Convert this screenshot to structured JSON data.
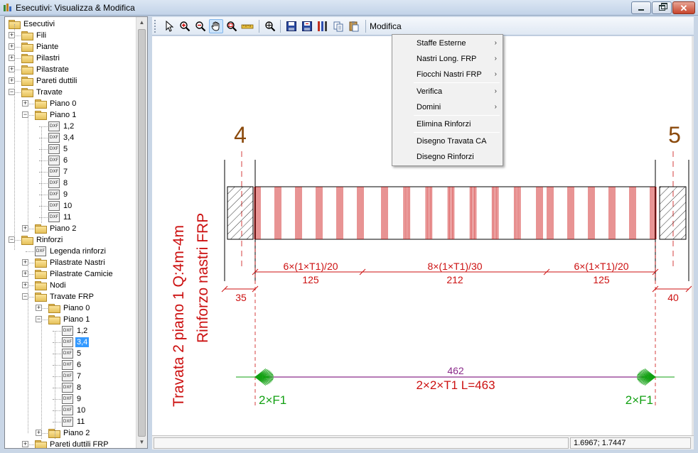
{
  "window": {
    "title": "Esecutivi: Visualizza & Modifica",
    "icon": "app-logo-icon"
  },
  "tree": {
    "items": [
      {
        "label": "Esecutivi",
        "icon": "folder-open-icon",
        "expander": "-"
      },
      {
        "label": "Fili",
        "icon": "folder-icon",
        "expander": "+"
      },
      {
        "label": "Piante",
        "icon": "folder-icon",
        "expander": "+"
      },
      {
        "label": "Pilastri",
        "icon": "folder-icon",
        "expander": "+"
      },
      {
        "label": "Pilastrate",
        "icon": "folder-icon",
        "expander": "+"
      },
      {
        "label": "Pareti duttili",
        "icon": "folder-icon",
        "expander": "+"
      },
      {
        "label": "Travate",
        "icon": "folder-open-icon",
        "expander": "-"
      },
      {
        "label": "Piano 0",
        "icon": "folder-icon",
        "expander": "+"
      },
      {
        "label": "Piano 1",
        "icon": "folder-open-icon",
        "expander": "-"
      },
      {
        "label": "1,2",
        "icon": "dxf-file-icon"
      },
      {
        "label": "3,4",
        "icon": "dxf-file-icon"
      },
      {
        "label": "5",
        "icon": "dxf-file-icon"
      },
      {
        "label": "6",
        "icon": "dxf-file-icon"
      },
      {
        "label": "7",
        "icon": "dxf-file-icon"
      },
      {
        "label": "8",
        "icon": "dxf-file-icon"
      },
      {
        "label": "9",
        "icon": "dxf-file-icon"
      },
      {
        "label": "10",
        "icon": "dxf-file-icon"
      },
      {
        "label": "11",
        "icon": "dxf-file-icon"
      },
      {
        "label": "Piano 2",
        "icon": "folder-icon",
        "expander": "+"
      },
      {
        "label": "Rinforzi",
        "icon": "folder-open-icon",
        "expander": "-"
      },
      {
        "label": "Legenda rinforzi",
        "icon": "dxf-file-icon"
      },
      {
        "label": "Pilastrate Nastri",
        "icon": "folder-icon",
        "expander": "+"
      },
      {
        "label": "Pilastrate Camicie",
        "icon": "folder-icon",
        "expander": "+"
      },
      {
        "label": "Nodi",
        "icon": "folder-icon",
        "expander": "+"
      },
      {
        "label": "Travate FRP",
        "icon": "folder-open-icon",
        "expander": "-"
      },
      {
        "label": "Piano 0",
        "icon": "folder-icon",
        "expander": "+"
      },
      {
        "label": "Piano 1",
        "icon": "folder-open-icon",
        "expander": "-"
      },
      {
        "label": "1,2",
        "icon": "dxf-file-icon"
      },
      {
        "label": "3,4",
        "icon": "dxf-file-icon",
        "selected": true
      },
      {
        "label": "5",
        "icon": "dxf-file-icon"
      },
      {
        "label": "6",
        "icon": "dxf-file-icon"
      },
      {
        "label": "7",
        "icon": "dxf-file-icon"
      },
      {
        "label": "8",
        "icon": "dxf-file-icon"
      },
      {
        "label": "9",
        "icon": "dxf-file-icon"
      },
      {
        "label": "10",
        "icon": "dxf-file-icon"
      },
      {
        "label": "11",
        "icon": "dxf-file-icon"
      },
      {
        "label": "Piano 2",
        "icon": "folder-icon",
        "expander": "+"
      },
      {
        "label": "Pareti duttili FRP",
        "icon": "folder-icon",
        "expander": "+"
      }
    ],
    "dxf_icon_text": "DXF"
  },
  "toolbar": {
    "buttons": [
      "pointer-icon",
      "zoom-in-icon",
      "zoom-out-icon",
      "pan-hand-icon",
      "zoom-window-icon",
      "measure-ruler-icon",
      "zoom-extents-icon",
      "save-icon",
      "save-as-icon",
      "tools-icon",
      "copy-icon",
      "paste-icon"
    ],
    "menu_label": "Modifica"
  },
  "context_menu": {
    "items": [
      {
        "label": "Staffe Esterne",
        "submenu": true
      },
      {
        "label": "Nastri Long. FRP",
        "submenu": true
      },
      {
        "label": "Fiocchi Nastri FRP",
        "submenu": true
      },
      {
        "label": "Verifica",
        "submenu": true
      },
      {
        "label": "Domini",
        "submenu": true
      },
      {
        "label": "Elimina Rinforzi",
        "submenu": false
      },
      {
        "label": "Disegno Travata CA",
        "submenu": false
      },
      {
        "label": "Disegno Rinforzi",
        "submenu": false
      }
    ],
    "submenu_arrow": "›"
  },
  "drawing": {
    "axis_left": "4",
    "axis_right": "5",
    "title_line1": "Travata 2 piano 1 Q:4m-4m",
    "title_line2": "Rinforzo nastri FRP",
    "stirrup_left": "6×(1×T1)/20",
    "stirrup_mid": "8×(1×T1)/30",
    "stirrup_right": "6×(1×T1)/20",
    "span_left": "125",
    "span_mid": "212",
    "span_right": "125",
    "support_left": "35",
    "support_right": "40",
    "total_length": "462",
    "strip_label": "2×2×T1 L=463",
    "anchor_left": "2×F1",
    "anchor_right": "2×F1",
    "colors": {
      "red": "#cc1010",
      "axis_brown": "#8b4a0c",
      "green": "#12a012",
      "purple": "#8a2a8a"
    }
  },
  "status": {
    "coords": "1.6967; 1.7447"
  }
}
